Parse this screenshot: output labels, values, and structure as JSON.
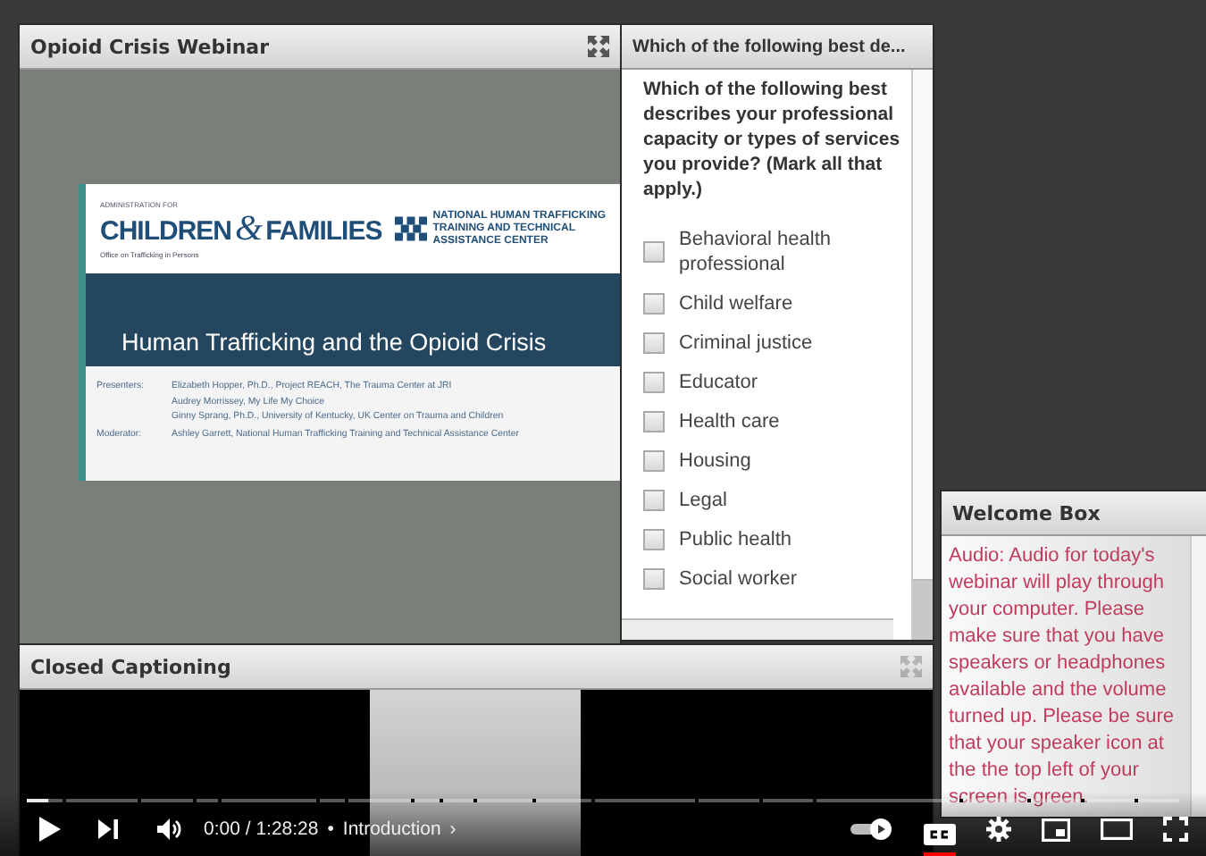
{
  "slide_pod": {
    "title": "Opioid Crisis Webinar",
    "slide": {
      "org_small": "ADMINISTRATION FOR",
      "org_left": "CHILDREN",
      "org_amp": "&",
      "org_right": "FAMILIES",
      "org_office": "Office on Trafficking in Persons",
      "partner_lines": [
        "NATIONAL HUMAN TRAFFICKING",
        "TRAINING AND TECHNICAL",
        "ASSISTANCE CENTER"
      ],
      "title": "Human Trafficking and the Opioid Crisis",
      "credits": [
        {
          "role": "Presenters:",
          "names": [
            "Elizabeth Hopper, Ph.D., Project REACH, The Trauma Center at JRI",
            "Audrey Morrissey, My Life My Choice",
            "Ginny Sprang, Ph.D., University of Kentucky, UK Center on Trauma and Children"
          ]
        },
        {
          "role": "Moderator:",
          "names": [
            "Ashley Garrett, National Human Trafficking Training and Technical Assistance Center"
          ]
        }
      ]
    }
  },
  "poll_pod": {
    "title": "Which of the following best de...",
    "question": "Which of the following best describes your professional capacity or types of services you provide? (Mark all that apply.)",
    "options": [
      {
        "label": "Behavioral health professional",
        "checked": false
      },
      {
        "label": "Child welfare",
        "checked": false
      },
      {
        "label": "Criminal justice",
        "checked": false
      },
      {
        "label": "Educator",
        "checked": false
      },
      {
        "label": "Health care",
        "checked": false
      },
      {
        "label": "Housing",
        "checked": false
      },
      {
        "label": "Legal",
        "checked": false
      },
      {
        "label": "Public health",
        "checked": false
      },
      {
        "label": "Social worker",
        "checked": false
      }
    ]
  },
  "captions_pod": {
    "title": "Closed Captioning"
  },
  "welcome_pod": {
    "title": "Welcome Box",
    "message": "Audio: Audio for today's webinar will play through your computer. Please make sure that you have speakers or headphones available and the volume turned up. Please be sure that your speaker icon at the the top left of your screen is green."
  },
  "player": {
    "progress": {
      "level": 0.018
    },
    "time": "0:00 / 1:28:28",
    "separator": "•",
    "chapter": "Introduction",
    "chapter_arrow": "›",
    "autoplay": {
      "on": true
    },
    "captions": {
      "on": true
    }
  }
}
